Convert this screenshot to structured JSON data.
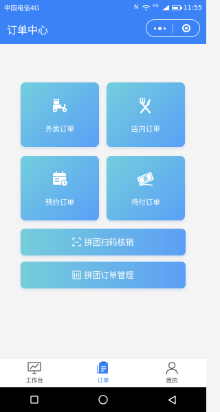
{
  "status_bar": {
    "carrier": "中国电信4G",
    "icons": [
      "nfc-icon",
      "wifi-icon",
      "signal-icon",
      "battery-icon"
    ],
    "signal_text": "⁴ᴳ",
    "battery_level": 0.8,
    "time": "11:55"
  },
  "nav_bar": {
    "title": "订单中心",
    "color": "#3b82f6"
  },
  "tiles": [
    {
      "label": "外卖订单",
      "icon": "scooter-icon"
    },
    {
      "label": "店内订单",
      "icon": "fork-knife-icon"
    },
    {
      "label": "预约订单",
      "icon": "calendar-clock-icon"
    },
    {
      "label": "待付订单",
      "icon": "cash-icon"
    }
  ],
  "buttons": {
    "scan_label": "拼团扫码核销",
    "manage_label": "拼团订单管理"
  },
  "tab_bar": {
    "items": [
      {
        "label": "工作台",
        "icon": "dashboard-icon"
      },
      {
        "label": "订单",
        "icon": "order-icon",
        "active": true
      },
      {
        "label": "我的",
        "icon": "user-icon"
      }
    ],
    "active_color": "#3b82f6"
  },
  "android_nav": [
    "recents-icon",
    "home-icon",
    "back-icon"
  ]
}
